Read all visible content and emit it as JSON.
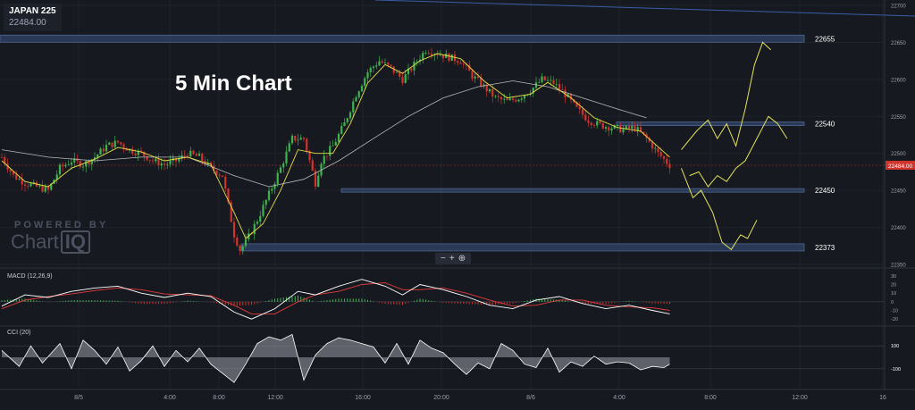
{
  "symbol": {
    "name": "JAPAN 225",
    "price": "22484.00"
  },
  "title": "5 Min Chart",
  "branding": {
    "powered_by": "POWERED BY",
    "name": "Chart",
    "name_boxed": "IQ"
  },
  "zoom_controls": [
    "−",
    "+",
    "⊕"
  ],
  "colors": {
    "background": "#16191f",
    "up_candle": "#3fb34f",
    "down_candle": "#d0342c",
    "price_tag": "#d0342c",
    "zone_fill": "#2e3f60",
    "zone_stroke": "#5a74a6",
    "projection": "#e3e35a",
    "macd_line": "#ffffff",
    "signal_line": "#e33b3b",
    "sma_fast": "#e6e04a",
    "sma_slow": "#b9b9b9"
  },
  "chart_data": [
    {
      "type": "candlestick",
      "title": "",
      "current_price": 22484,
      "ylim": [
        22350,
        22700
      ],
      "y_ticks": [
        22350,
        22400,
        22450,
        22500,
        22550,
        22600,
        22650,
        22700
      ],
      "x_ticks": [
        "8/5",
        "4:00",
        "8:00",
        "12:00",
        "16:00",
        "20:00",
        "8/6",
        "4:00",
        "8:00",
        "12:00",
        "16"
      ],
      "horizontal_levels": [
        {
          "label": "22655",
          "value": 22655
        },
        {
          "label": "22540",
          "value": 22540
        },
        {
          "label": "22450",
          "value": 22450
        },
        {
          "label": "22373",
          "value": 22373
        }
      ],
      "price_path": [
        [
          0,
          22495
        ],
        [
          10,
          22470
        ],
        [
          20,
          22460
        ],
        [
          30,
          22455
        ],
        [
          40,
          22450
        ],
        [
          50,
          22480
        ],
        [
          60,
          22490
        ],
        [
          70,
          22485
        ],
        [
          80,
          22495
        ],
        [
          90,
          22510
        ],
        [
          100,
          22515
        ],
        [
          110,
          22505
        ],
        [
          120,
          22500
        ],
        [
          130,
          22490
        ],
        [
          140,
          22485
        ],
        [
          150,
          22490
        ],
        [
          160,
          22500
        ],
        [
          170,
          22495
        ],
        [
          180,
          22480
        ],
        [
          190,
          22470
        ],
        [
          195,
          22430
        ],
        [
          200,
          22390
        ],
        [
          205,
          22370
        ],
        [
          210,
          22380
        ],
        [
          220,
          22410
        ],
        [
          230,
          22445
        ],
        [
          240,
          22480
        ],
        [
          250,
          22520
        ],
        [
          260,
          22520
        ],
        [
          265,
          22490
        ],
        [
          270,
          22460
        ],
        [
          275,
          22490
        ],
        [
          285,
          22510
        ],
        [
          295,
          22540
        ],
        [
          305,
          22580
        ],
        [
          315,
          22610
        ],
        [
          325,
          22625
        ],
        [
          335,
          22615
        ],
        [
          345,
          22600
        ],
        [
          355,
          22620
        ],
        [
          365,
          22640
        ],
        [
          375,
          22635
        ],
        [
          385,
          22630
        ],
        [
          395,
          22625
        ],
        [
          405,
          22605
        ],
        [
          415,
          22590
        ],
        [
          425,
          22575
        ],
        [
          435,
          22570
        ],
        [
          445,
          22575
        ],
        [
          455,
          22585
        ],
        [
          465,
          22600
        ],
        [
          475,
          22595
        ],
        [
          485,
          22580
        ],
        [
          495,
          22560
        ],
        [
          505,
          22545
        ],
        [
          515,
          22538
        ],
        [
          525,
          22535
        ],
        [
          535,
          22532
        ],
        [
          545,
          22535
        ],
        [
          555,
          22520
        ],
        [
          565,
          22500
        ],
        [
          575,
          22484
        ]
      ],
      "sma_fast": [
        [
          0,
          22490
        ],
        [
          20,
          22462
        ],
        [
          40,
          22455
        ],
        [
          60,
          22480
        ],
        [
          80,
          22492
        ],
        [
          100,
          22508
        ],
        [
          120,
          22502
        ],
        [
          140,
          22490
        ],
        [
          160,
          22495
        ],
        [
          180,
          22485
        ],
        [
          200,
          22420
        ],
        [
          210,
          22385
        ],
        [
          225,
          22405
        ],
        [
          240,
          22450
        ],
        [
          255,
          22505
        ],
        [
          270,
          22500
        ],
        [
          285,
          22500
        ],
        [
          300,
          22540
        ],
        [
          315,
          22595
        ],
        [
          330,
          22620
        ],
        [
          345,
          22608
        ],
        [
          360,
          22625
        ],
        [
          375,
          22635
        ],
        [
          395,
          22628
        ],
        [
          415,
          22598
        ],
        [
          435,
          22575
        ],
        [
          455,
          22580
        ],
        [
          470,
          22596
        ],
        [
          490,
          22575
        ],
        [
          510,
          22548
        ],
        [
          530,
          22535
        ],
        [
          550,
          22530
        ],
        [
          575,
          22495
        ]
      ],
      "sma_slow": [
        [
          0,
          22505
        ],
        [
          40,
          22495
        ],
        [
          80,
          22490
        ],
        [
          120,
          22495
        ],
        [
          160,
          22495
        ],
        [
          200,
          22470
        ],
        [
          230,
          22455
        ],
        [
          260,
          22465
        ],
        [
          290,
          22490
        ],
        [
          320,
          22520
        ],
        [
          350,
          22550
        ],
        [
          380,
          22575
        ],
        [
          410,
          22590
        ],
        [
          440,
          22598
        ],
        [
          470,
          22590
        ],
        [
          500,
          22575
        ],
        [
          530,
          22560
        ],
        [
          555,
          22548
        ]
      ],
      "projection_a": [
        [
          585,
          22505
        ],
        [
          598,
          22530
        ],
        [
          608,
          22545
        ],
        [
          616,
          22520
        ],
        [
          624,
          22540
        ],
        [
          632,
          22510
        ],
        [
          640,
          22560
        ],
        [
          648,
          22620
        ],
        [
          655,
          22650
        ],
        [
          662,
          22640
        ]
      ],
      "projection_b": [
        [
          592,
          22470
        ],
        [
          600,
          22475
        ],
        [
          608,
          22455
        ],
        [
          616,
          22470
        ],
        [
          624,
          22462
        ],
        [
          632,
          22480
        ],
        [
          640,
          22490
        ],
        [
          650,
          22520
        ],
        [
          660,
          22550
        ],
        [
          668,
          22540
        ],
        [
          676,
          22520
        ]
      ],
      "projection_c": [
        [
          585,
          22480
        ],
        [
          595,
          22440
        ],
        [
          602,
          22450
        ],
        [
          612,
          22420
        ],
        [
          620,
          22380
        ],
        [
          628,
          22370
        ],
        [
          636,
          22390
        ],
        [
          642,
          22385
        ],
        [
          650,
          22410
        ]
      ]
    },
    {
      "type": "line",
      "title": "MACD (12,26,9)",
      "ylim": [
        -25,
        35
      ],
      "y_ticks": [
        30,
        20,
        10,
        0,
        -10,
        -20
      ],
      "series": [
        {
          "name": "",
          "points": [
            [
              0,
              -5
            ],
            [
              20,
              8
            ],
            [
              40,
              5
            ],
            [
              60,
              12
            ],
            [
              80,
              16
            ],
            [
              100,
              18
            ],
            [
              120,
              10
            ],
            [
              140,
              5
            ],
            [
              160,
              10
            ],
            [
              180,
              6
            ],
            [
              200,
              -12
            ],
            [
              215,
              -20
            ],
            [
              235,
              -8
            ],
            [
              255,
              12
            ],
            [
              270,
              8
            ],
            [
              290,
              18
            ],
            [
              310,
              26
            ],
            [
              330,
              18
            ],
            [
              345,
              8
            ],
            [
              360,
              20
            ],
            [
              380,
              14
            ],
            [
              400,
              6
            ],
            [
              420,
              -4
            ],
            [
              440,
              -8
            ],
            [
              460,
              2
            ],
            [
              480,
              6
            ],
            [
              500,
              -2
            ],
            [
              520,
              -8
            ],
            [
              540,
              -4
            ],
            [
              560,
              -10
            ],
            [
              575,
              -14
            ]
          ]
        },
        {
          "name": "",
          "points": [
            [
              0,
              -8
            ],
            [
              20,
              2
            ],
            [
              40,
              6
            ],
            [
              60,
              9
            ],
            [
              80,
              13
            ],
            [
              100,
              16
            ],
            [
              120,
              14
            ],
            [
              140,
              9
            ],
            [
              160,
              8
            ],
            [
              180,
              7
            ],
            [
              200,
              -4
            ],
            [
              215,
              -14
            ],
            [
              235,
              -14
            ],
            [
              255,
              0
            ],
            [
              270,
              8
            ],
            [
              290,
              12
            ],
            [
              310,
              20
            ],
            [
              330,
              22
            ],
            [
              345,
              14
            ],
            [
              360,
              14
            ],
            [
              380,
              16
            ],
            [
              400,
              10
            ],
            [
              420,
              2
            ],
            [
              440,
              -5
            ],
            [
              460,
              -4
            ],
            [
              480,
              2
            ],
            [
              500,
              2
            ],
            [
              520,
              -4
            ],
            [
              540,
              -6
            ],
            [
              560,
              -7
            ],
            [
              575,
              -10
            ]
          ]
        }
      ]
    },
    {
      "type": "area",
      "title": "CCI (20)",
      "ylim": [
        -250,
        250
      ],
      "y_ticks": [
        100,
        -100
      ],
      "series": [
        {
          "name": "",
          "points": [
            [
              0,
              60
            ],
            [
              15,
              -80
            ],
            [
              25,
              100
            ],
            [
              35,
              -50
            ],
            [
              50,
              120
            ],
            [
              60,
              -100
            ],
            [
              70,
              150
            ],
            [
              80,
              60
            ],
            [
              90,
              -60
            ],
            [
              100,
              90
            ],
            [
              110,
              -120
            ],
            [
              120,
              -30
            ],
            [
              130,
              100
            ],
            [
              140,
              -80
            ],
            [
              150,
              60
            ],
            [
              160,
              -40
            ],
            [
              170,
              80
            ],
            [
              180,
              -60
            ],
            [
              190,
              -140
            ],
            [
              200,
              -220
            ],
            [
              210,
              -60
            ],
            [
              220,
              120
            ],
            [
              230,
              180
            ],
            [
              240,
              150
            ],
            [
              250,
              200
            ],
            [
              260,
              -200
            ],
            [
              270,
              20
            ],
            [
              280,
              120
            ],
            [
              290,
              170
            ],
            [
              300,
              150
            ],
            [
              310,
              120
            ],
            [
              320,
              90
            ],
            [
              330,
              -50
            ],
            [
              340,
              120
            ],
            [
              350,
              -60
            ],
            [
              360,
              150
            ],
            [
              370,
              80
            ],
            [
              380,
              40
            ],
            [
              390,
              -60
            ],
            [
              400,
              -150
            ],
            [
              410,
              -50
            ],
            [
              420,
              -100
            ],
            [
              430,
              120
            ],
            [
              440,
              60
            ],
            [
              450,
              -60
            ],
            [
              460,
              -90
            ],
            [
              470,
              80
            ],
            [
              480,
              -130
            ],
            [
              490,
              -40
            ],
            [
              500,
              -80
            ],
            [
              510,
              10
            ],
            [
              520,
              -60
            ],
            [
              530,
              -40
            ],
            [
              540,
              -50
            ],
            [
              550,
              -110
            ],
            [
              560,
              -80
            ],
            [
              570,
              -90
            ],
            [
              575,
              -60
            ]
          ]
        }
      ]
    }
  ]
}
